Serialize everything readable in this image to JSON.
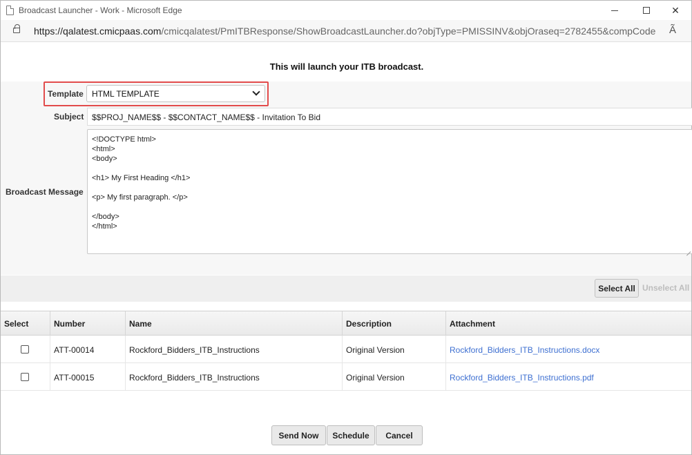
{
  "window": {
    "title": "Broadcast Launcher - Work - Microsoft Edge",
    "minimize_glyph": "",
    "close_glyph": "✕"
  },
  "address": {
    "url_host": "https://qalatest.cmicpaas.com",
    "url_path": "/cmicqalatest/PmITBResponse/ShowBroadcastLauncher.do?objType=PMISSINV&objOraseq=2782455&compCode...",
    "read_aloud_glyph": "Ã"
  },
  "page": {
    "heading": "This will launch your ITB broadcast."
  },
  "form": {
    "template_label": "Template",
    "template_value": "HTML TEMPLATE",
    "subject_label": "Subject",
    "subject_value": "$$PROJ_NAME$$  - $$CONTACT_NAME$$ - Invitation To Bid",
    "message_label": "Broadcast Message",
    "message_value": "<!DOCTYPE html>\n<html>\n<body>\n\n<h1> My First Heading </h1>\n\n<p> My first paragraph. </p>\n\n</body>\n</html>"
  },
  "toolbar": {
    "select_all": "Select All",
    "unselect_all": "Unselect All"
  },
  "table": {
    "headers": [
      "Select",
      "Number",
      "Name",
      "Description",
      "Attachment"
    ],
    "rows": [
      {
        "checked": false,
        "number": "ATT-00014",
        "name": "Rockford_Bidders_ITB_Instructions",
        "description": "Original Version",
        "attachment": "Rockford_Bidders_ITB_Instructions.docx"
      },
      {
        "checked": false,
        "number": "ATT-00015",
        "name": "Rockford_Bidders_ITB_Instructions",
        "description": "Original Version",
        "attachment": "Rockford_Bidders_ITB_Instructions.pdf"
      }
    ]
  },
  "actions": {
    "send_now": "Send Now",
    "schedule": "Schedule",
    "cancel": "Cancel"
  },
  "colors": {
    "highlight_border": "#e24b4b",
    "link": "#3d6fd1"
  }
}
